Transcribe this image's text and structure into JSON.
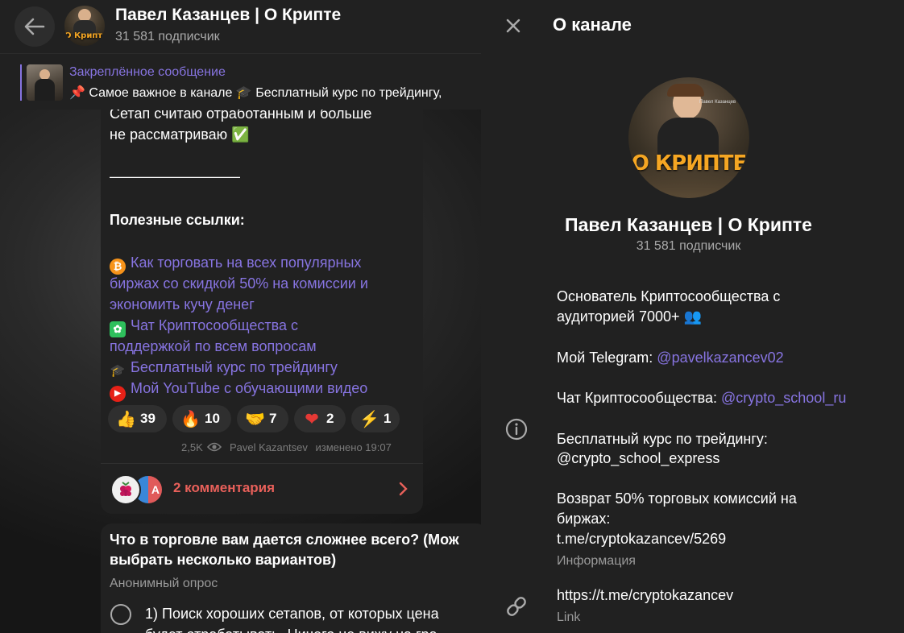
{
  "chat_header": {
    "title": "Павел Казанцев | О Крипте",
    "subscribers": "31 581 подписчик",
    "avatar_logo": "О Крипте"
  },
  "pinned": {
    "label": "Закреплённое сообщение",
    "text": "📌 Самое важное в канале 🎓 Бесплатный курс по трейдингу,"
  },
  "message": {
    "lines": [
      "Сетап считаю отработанным и больше",
      "не рассматриваю ✅",
      "—————————",
      "Полезные ссылки:"
    ],
    "links": [
      {
        "icon": "bitcoin-icon",
        "lines": [
          "Как торговать на всех популярных",
          "биржах со скидкой 50% на комиссии и",
          "экономить кучу денег"
        ]
      },
      {
        "icon": "wechat-icon",
        "lines": [
          "Чат Криптосообщества с",
          "поддержкой по всем вопросам"
        ]
      },
      {
        "icon": "graduation-cap-icon",
        "lines": [
          "Бесплатный курс по трейдингу"
        ]
      },
      {
        "icon": "youtube-icon",
        "lines": [
          "Мой YouTube с обучающими видео"
        ]
      }
    ],
    "reactions": [
      {
        "emoji": "👍",
        "count": "39"
      },
      {
        "emoji": "🔥",
        "count": "10"
      },
      {
        "emoji": "🤝",
        "count": "7"
      },
      {
        "emoji": "❤",
        "count": "2"
      },
      {
        "emoji": "⚡",
        "count": "1"
      }
    ],
    "views": "2,5K",
    "author": "Pavel Kazantsev",
    "edited": "изменено 19:07",
    "comments": "2 комментария",
    "commenter_initials": "А"
  },
  "poll": {
    "question_line1": "Что в торговле вам дается сложнее всего? (Мож",
    "question_line2": "выбрать несколько вариантов)",
    "type": "Анонимный опрос",
    "option_line1": "1) Поиск хороших сетапов, от которых цена",
    "option_line2": "будет отрабатывать. Ничего не вижу на гра"
  },
  "panel": {
    "title": "О канале",
    "name": "Павел Казанцев | О Крипте",
    "subscribers": "31 581 подписчик",
    "avatar_logo": "О КРИПТЕ",
    "avatar_caption": "Павел Казанцев",
    "description": {
      "line1": "Основатель Криптосообщества с",
      "line2": "аудиторией 7000+ 👥",
      "tg_prefix": "Мой Telegram: ",
      "tg_handle": "@pavelkazancev02",
      "chat_prefix": "Чат Криптосообщества: ",
      "chat_handle": "@crypto_school_ru",
      "course_label": "Бесплатный курс по трейдингу:",
      "course_handle": "@crypto_school_express",
      "refund_line1": "Возврат 50% торговых комиссий на",
      "refund_line2": "биржах:",
      "refund_link": "t.me/cryptokazancev/5269"
    },
    "info_label": "Информация",
    "link_value": "https://t.me/cryptokazancev",
    "link_label": "Link"
  },
  "colors": {
    "accent": "#8774e1",
    "comments": "#e8605a",
    "panel_bg": "#212121",
    "bubble_bg": "#212121"
  }
}
